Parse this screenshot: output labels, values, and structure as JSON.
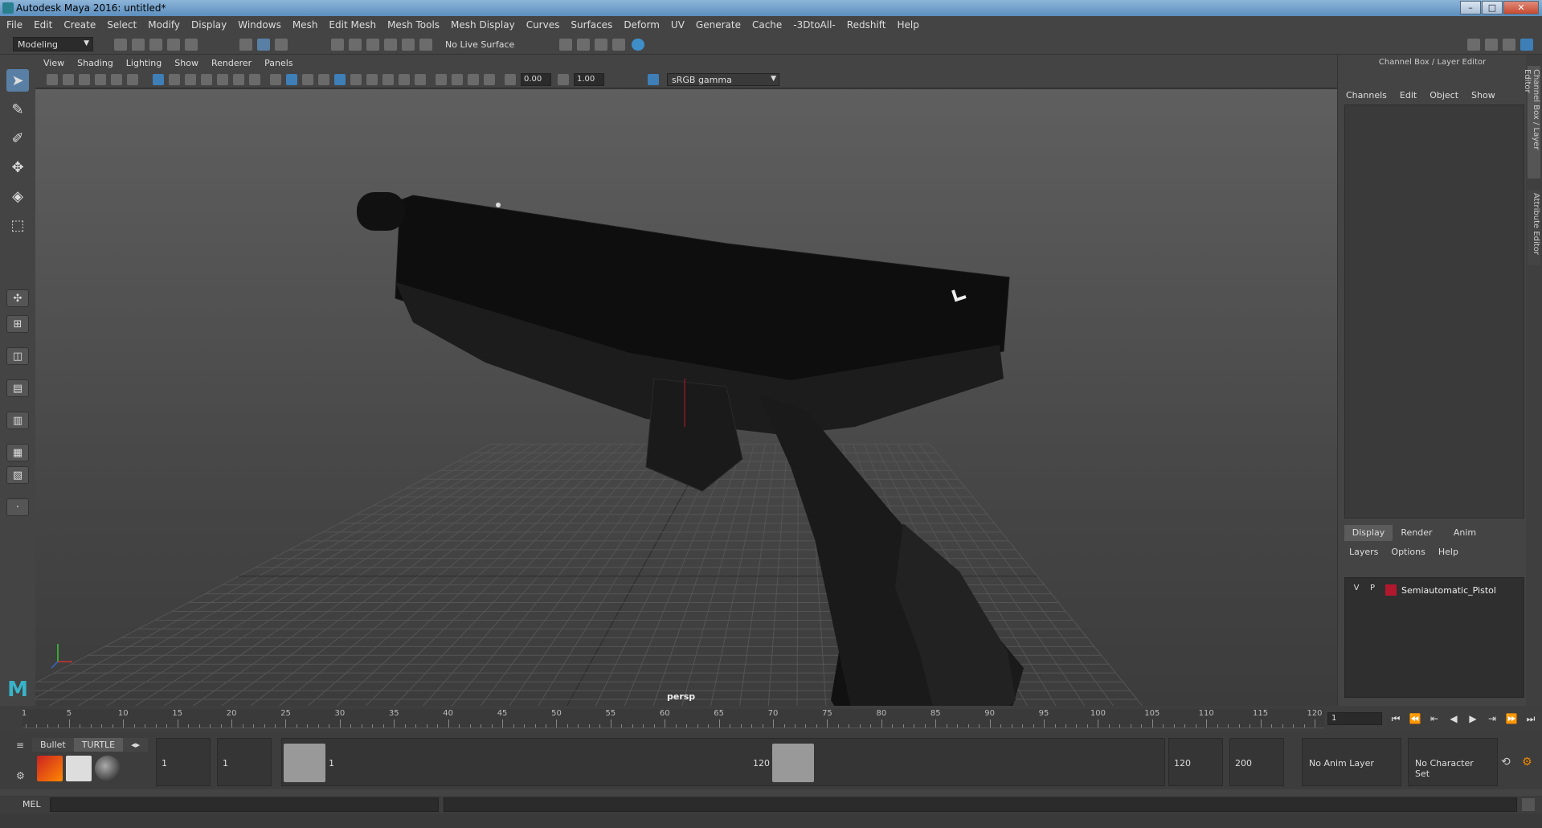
{
  "window": {
    "title": "Autodesk Maya 2016: untitled*",
    "minimize": "–",
    "maximize": "□",
    "close": "✕"
  },
  "menubar": [
    "File",
    "Edit",
    "Create",
    "Select",
    "Modify",
    "Display",
    "Windows",
    "Mesh",
    "Edit Mesh",
    "Mesh Tools",
    "Mesh Display",
    "Curves",
    "Surfaces",
    "Deform",
    "UV",
    "Generate",
    "Cache",
    "-3DtoAll-",
    "Redshift",
    "Help"
  ],
  "statusline": {
    "mode": "Modeling",
    "live_surface": "No Live Surface"
  },
  "viewport": {
    "menu": [
      "View",
      "Shading",
      "Lighting",
      "Show",
      "Renderer",
      "Panels"
    ],
    "exposure": "0.00",
    "gamma": "1.00",
    "color_space": "sRGB gamma",
    "camera": "persp"
  },
  "channelbox": {
    "title": "Channel Box / Layer Editor",
    "menu": [
      "Channels",
      "Edit",
      "Object",
      "Show"
    ],
    "layer_tabs": [
      "Display",
      "Render",
      "Anim"
    ],
    "layer_menu": [
      "Layers",
      "Options",
      "Help"
    ],
    "layer": {
      "v": "V",
      "p": "P",
      "name": "Semiautomatic_Pistol",
      "color": "#b0182e"
    }
  },
  "side_tabs": [
    "Channel Box / Layer Editor",
    "Attribute Editor"
  ],
  "timeslider": {
    "ticks": [
      "5",
      "10",
      "15",
      "20",
      "25",
      "30",
      "35",
      "40",
      "45",
      "50",
      "55",
      "60",
      "65",
      "70",
      "75",
      "80",
      "85",
      "90",
      "95",
      "100",
      "105",
      "110",
      "115",
      "120"
    ],
    "start_marker": "1",
    "current_frame": "1"
  },
  "shelf": {
    "tabs": [
      "Bullet",
      "TURTLE"
    ]
  },
  "range": {
    "start": "1",
    "playback_start": "1",
    "handle_start": "1",
    "handle_end": "120",
    "playback_end": "120",
    "end": "200",
    "anim_layer": "No Anim Layer",
    "character_set": "No Character Set"
  },
  "command": {
    "label": "MEL"
  }
}
